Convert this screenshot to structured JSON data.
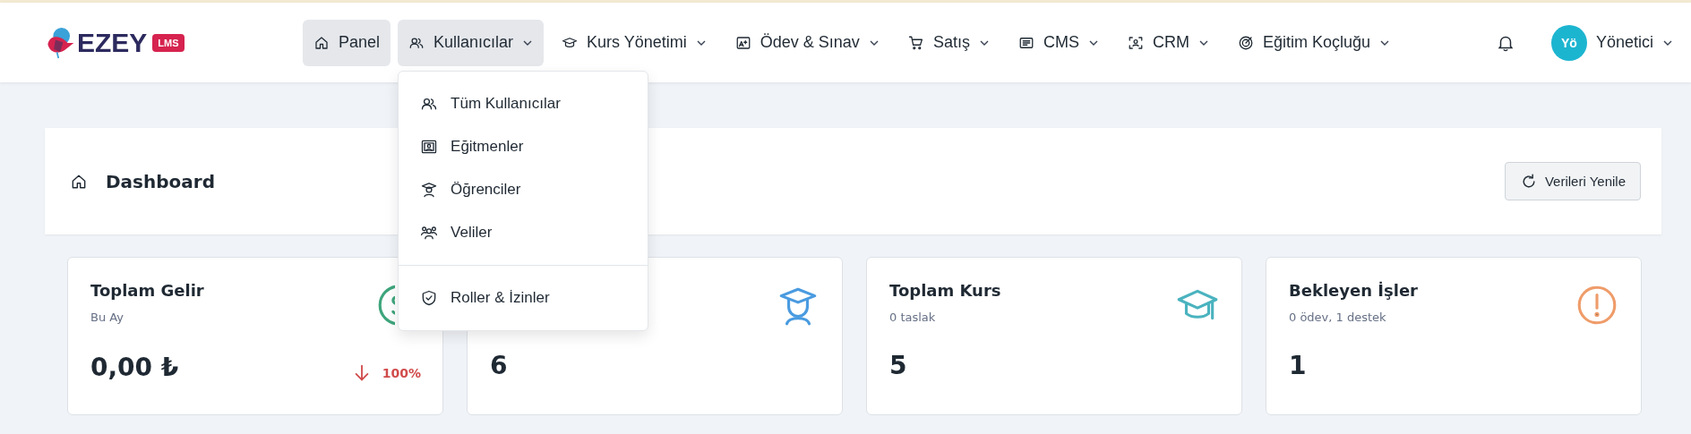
{
  "logo": {
    "name": "EZEY",
    "badge": "LMS"
  },
  "nav": [
    {
      "label": "Panel",
      "selected": true,
      "expanded": false,
      "dropdown": false
    },
    {
      "label": "Kullanıcılar",
      "selected": true,
      "expanded": true,
      "dropdown": true
    },
    {
      "label": "Kurs Yönetimi",
      "selected": false,
      "expanded": false,
      "dropdown": true
    },
    {
      "label": "Ödev & Sınav",
      "selected": false,
      "expanded": false,
      "dropdown": true
    },
    {
      "label": "Satış",
      "selected": false,
      "expanded": false,
      "dropdown": true
    },
    {
      "label": "CMS",
      "selected": false,
      "expanded": false,
      "dropdown": true
    },
    {
      "label": "CRM",
      "selected": false,
      "expanded": false,
      "dropdown": true
    },
    {
      "label": "Eğitim Koçluğu",
      "selected": false,
      "expanded": false,
      "dropdown": true
    }
  ],
  "user_menu": {
    "initials": "Yö",
    "name": "Yönetici"
  },
  "dropdown_menu": {
    "groups": [
      [
        "Tüm Kullanıcılar",
        "Eğitmenler",
        "Öğrenciler",
        "Veliler"
      ],
      [
        "Roller & İzinler"
      ]
    ]
  },
  "page_header": {
    "title": "Dashboard",
    "refresh_button": "Verileri Yenile"
  },
  "stats": [
    {
      "title": "Toplam Gelir",
      "subtitle": "Bu Ay",
      "value": "0,00 ₺",
      "trend": {
        "text": "100%"
      }
    },
    {
      "value": "6"
    },
    {
      "title": "Toplam Kurs",
      "subtitle": "0 taslak",
      "value": "5"
    },
    {
      "title": "Bekleyen İşler",
      "subtitle": "0 ödev, 1 destek",
      "value": "1"
    }
  ]
}
